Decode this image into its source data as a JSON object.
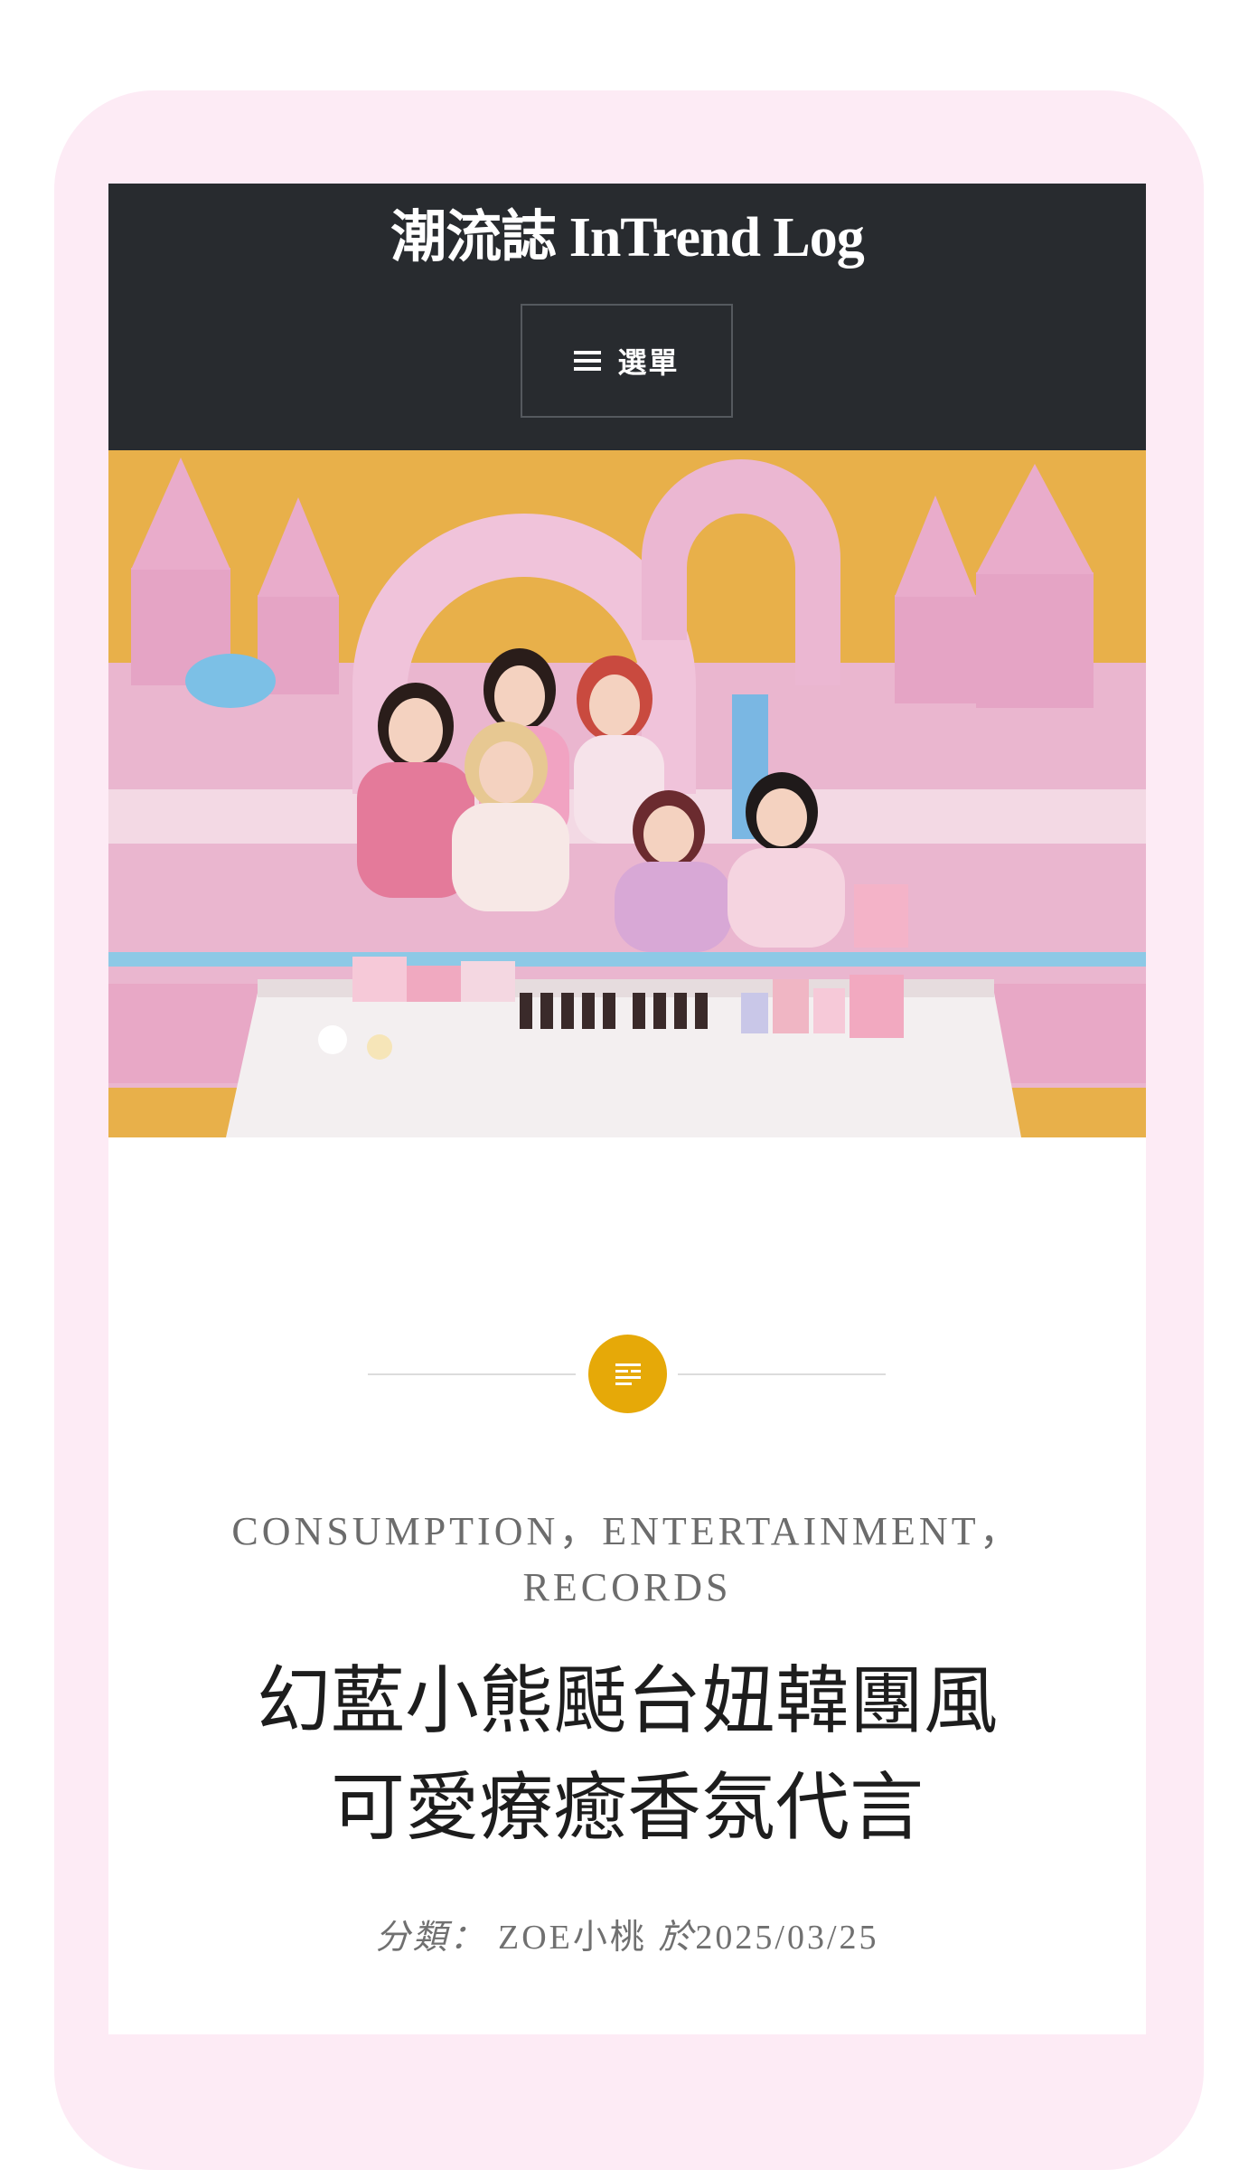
{
  "header": {
    "site_title": "潮流誌 InTrend Log",
    "menu_label": "選單"
  },
  "hero": {
    "alt": "幻藍小熊颳台妞韓團風可愛療癒香氛代言"
  },
  "post": {
    "categories": [
      "CONSUMPTION",
      "ENTERTAINMENT",
      "RECORDS"
    ],
    "category_separator": "，",
    "title_line1": "幻藍小熊颳台妞韓團風",
    "title_line2": "可愛療癒香氛代言",
    "meta_category_label": "分類：",
    "author": "ZOE小桃",
    "date_prefix": "於",
    "date": "2025/03/25"
  },
  "colors": {
    "page_frame": "#fdebf5",
    "header_bg": "#282b2f",
    "accent": "#e6a908"
  },
  "icons": {
    "menu": "hamburger-icon",
    "post_format": "text-format-icon"
  }
}
